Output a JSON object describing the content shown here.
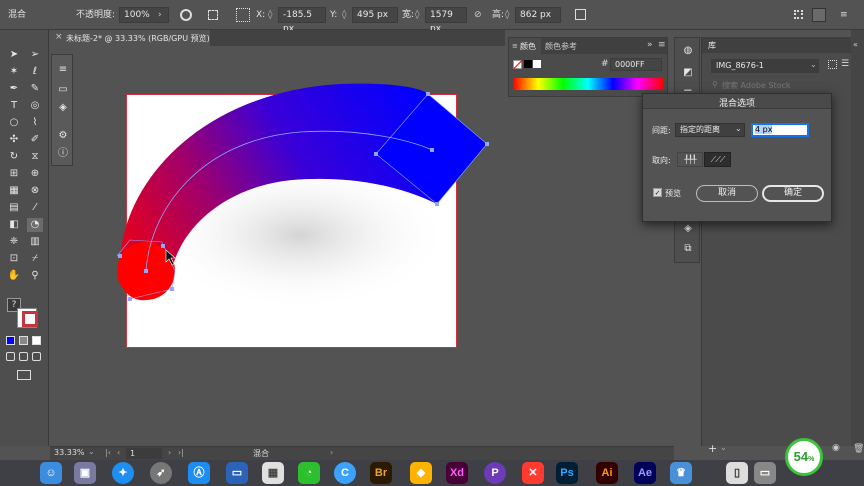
{
  "controlbar": {
    "mode": "混合",
    "opacity_label": "不透明度:",
    "opacity_value": "100%",
    "x_label": "X:",
    "x_value": "-185.5 px",
    "y_label": "Y:",
    "y_value": "495 px",
    "w_label": "宽:",
    "w_value": "1579 px",
    "h_label": "高:",
    "h_value": "862 px"
  },
  "document_tab": {
    "close": "×",
    "title": "未标题-2* @ 33.33% (RGB/GPU 预览)"
  },
  "color_panel": {
    "tab_color": "颜色",
    "tab_guide": "颜色参考",
    "hex_label": "#",
    "hex_value": "0000FF"
  },
  "library": {
    "title": "库",
    "dropdown_value": "IMG_8676-1",
    "search_placeholder": "搜索 Adobe Stock"
  },
  "dialog": {
    "title": "混合选项",
    "spacing_label": "间距:",
    "spacing_option": "指定的距离",
    "spacing_value": "4 px",
    "orientation_label": "取向:",
    "preview_label": "预览",
    "cancel_label": "取消",
    "ok_label": "确定"
  },
  "status": {
    "zoom": "33.33%",
    "page": "1",
    "tool": "混合"
  },
  "dock": {
    "apps": [
      "Br",
      "Xd",
      "Ps",
      "Ai",
      "Ae"
    ],
    "badge": "54",
    "badge_unit": "%"
  },
  "colors": {
    "blend_start": "#ff0000",
    "blend_end": "#0000ff",
    "artboard_border": "#c8343e",
    "accent_field": "#1473e6"
  }
}
